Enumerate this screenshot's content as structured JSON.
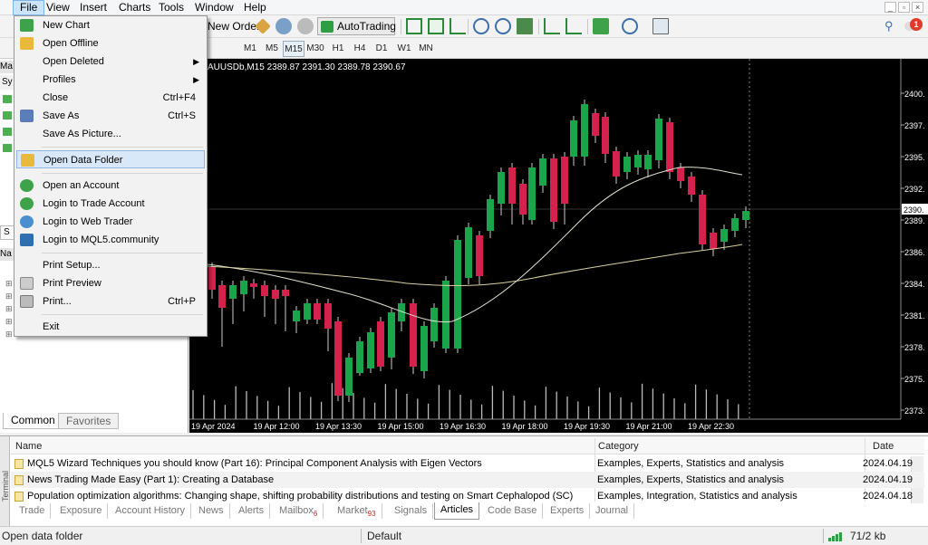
{
  "menubar": {
    "items": [
      "File",
      "View",
      "Insert",
      "Charts",
      "Tools",
      "Window",
      "Help"
    ],
    "notification_count": "1"
  },
  "toolbar": {
    "new_order_label": "New Order",
    "autotrading_label": "AutoTrading",
    "timeframes": [
      "M1",
      "M5",
      "M15",
      "M30",
      "H1",
      "H4",
      "D1",
      "W1",
      "MN"
    ],
    "active_timeframe": "M15"
  },
  "file_menu": {
    "items": [
      {
        "label": "New Chart",
        "shortcut": "",
        "submenu": false
      },
      {
        "label": "Open Offline",
        "shortcut": "",
        "submenu": false
      },
      {
        "label": "Open Deleted",
        "shortcut": "",
        "submenu": true
      },
      {
        "label": "Profiles",
        "shortcut": "",
        "submenu": true
      },
      {
        "label": "Close",
        "shortcut": "Ctrl+F4",
        "submenu": false
      },
      {
        "label": "Save As",
        "shortcut": "Ctrl+S",
        "submenu": false
      },
      {
        "label": "Save As Picture...",
        "shortcut": "",
        "submenu": false
      },
      {
        "label": "Open Data Folder",
        "shortcut": "",
        "submenu": false
      },
      {
        "label": "Open an Account",
        "shortcut": "",
        "submenu": false
      },
      {
        "label": "Login to Trade Account",
        "shortcut": "",
        "submenu": false
      },
      {
        "label": "Login to Web Trader",
        "shortcut": "",
        "submenu": false
      },
      {
        "label": "Login to MQL5.community",
        "shortcut": "",
        "submenu": false
      },
      {
        "label": "Print Setup...",
        "shortcut": "",
        "submenu": false
      },
      {
        "label": "Print Preview",
        "shortcut": "",
        "submenu": false
      },
      {
        "label": "Print...",
        "shortcut": "Ctrl+P",
        "submenu": false
      },
      {
        "label": "Exit",
        "shortcut": "",
        "submenu": false
      }
    ],
    "highlighted": "Open Data Folder"
  },
  "left_panel": {
    "market_watch_fragment": "Ma",
    "symbol_fragment": "Sy",
    "navigator_fragment": "Na",
    "s_tab": "S",
    "tabs": [
      "Common",
      "Favorites"
    ],
    "active_tab": "Common"
  },
  "chart": {
    "header": "AUUSDb,M15  2389.87 2391.30 2389.78 2390.67",
    "current_price": "2390.",
    "price_labels": [
      "2400.",
      "2397.",
      "2395.",
      "2392.",
      "2389.",
      "2386.",
      "2384.",
      "2381.",
      "2378.",
      "2375.",
      "2373."
    ],
    "time_labels": [
      "19 Apr 2024",
      "19 Apr 12:00",
      "19 Apr 13:30",
      "19 Apr 15:00",
      "19 Apr 16:30",
      "19 Apr 18:00",
      "19 Apr 19:30",
      "19 Apr 21:00",
      "19 Apr 22:30"
    ],
    "colors": {
      "bull": "#1aa54a",
      "bear": "#d4214e",
      "ma_fast": "#e0e0d0",
      "ma_slow": "#d8d0a0",
      "background": "#000000"
    }
  },
  "terminal": {
    "columns": [
      "Name",
      "Category",
      "Date"
    ],
    "rows": [
      {
        "name": "MQL5 Wizard Techniques you should know (Part 16): Principal Component Analysis with Eigen Vectors",
        "category": "Examples, Experts, Statistics and analysis",
        "date": "2024.04.19"
      },
      {
        "name": "News Trading Made Easy (Part 1): Creating a Database",
        "category": "Examples, Experts, Statistics and analysis",
        "date": "2024.04.19"
      },
      {
        "name": "Population optimization algorithms: Changing shape, shifting probability distributions and testing on Smart Cephalopod (SC)",
        "category": "Examples, Integration, Statistics and analysis",
        "date": "2024.04.18"
      }
    ],
    "side_label": "Terminal",
    "tabs": [
      {
        "label": "Trade",
        "badge": ""
      },
      {
        "label": "Exposure",
        "badge": ""
      },
      {
        "label": "Account History",
        "badge": ""
      },
      {
        "label": "News",
        "badge": ""
      },
      {
        "label": "Alerts",
        "badge": ""
      },
      {
        "label": "Mailbox",
        "badge": "6"
      },
      {
        "label": "Market",
        "badge": "93"
      },
      {
        "label": "Signals",
        "badge": ""
      },
      {
        "label": "Articles",
        "badge": ""
      },
      {
        "label": "Code Base",
        "badge": ""
      },
      {
        "label": "Experts",
        "badge": ""
      },
      {
        "label": "Journal",
        "badge": ""
      }
    ],
    "active_tab": "Articles"
  },
  "statusbar": {
    "hint": "Open data folder",
    "profile": "Default",
    "traffic": "71/2 kb"
  }
}
